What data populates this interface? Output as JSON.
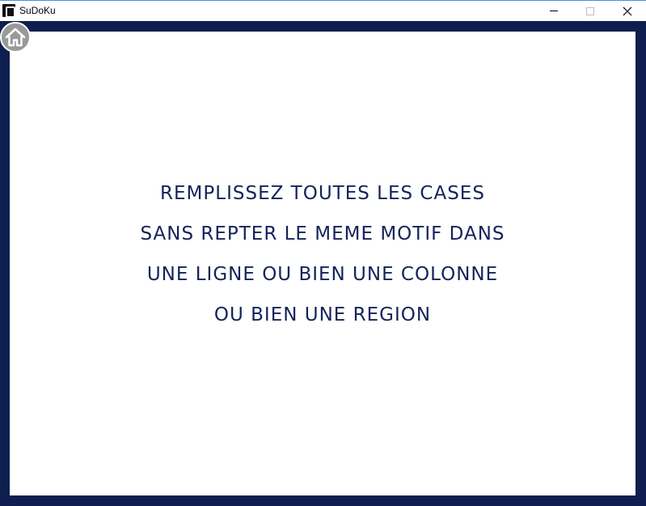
{
  "window": {
    "title": "SuDoKu",
    "app_icon": "sudoku-app-icon",
    "controls": [
      "minimize-icon",
      "maximize-icon",
      "close-icon"
    ]
  },
  "home": {
    "icon": "home-icon"
  },
  "instructions": {
    "lines": [
      "REMPLISSEZ TOUTES LES CASES",
      "SANS REPTER LE MEME MOTIF DANS",
      "UNE LIGNE OU BIEN UNE COLONNE",
      "OU BIEN UNE REGION"
    ]
  },
  "colors": {
    "frame": "#0e1f4f",
    "text": "#13235a",
    "panel": "#ffffff",
    "home_button": "#9a9a9a"
  }
}
